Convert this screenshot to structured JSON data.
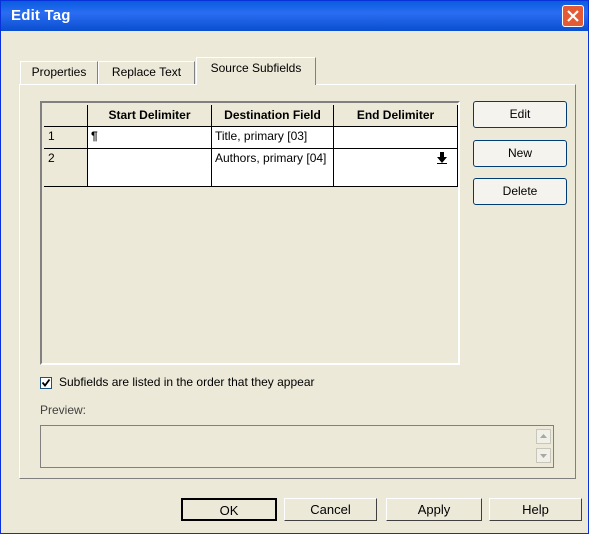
{
  "window": {
    "title": "Edit Tag",
    "title_bar_color": "#0a5cdf",
    "close_icon": "close-icon"
  },
  "tabs": [
    {
      "label": "Properties",
      "active": false
    },
    {
      "label": "Replace Text",
      "active": false
    },
    {
      "label": "Source Subfields",
      "active": true
    }
  ],
  "grid": {
    "columns": [
      "Start Delimiter",
      "Destination Field",
      "End Delimiter"
    ],
    "rows": [
      {
        "num": "1",
        "start": "¶",
        "dest": "Title, primary [03]",
        "end": ""
      },
      {
        "num": "2",
        "start": "",
        "dest": "Authors, primary [04]",
        "end": ""
      }
    ]
  },
  "side_buttons": {
    "edit": "Edit",
    "new": "New",
    "delete": "Delete"
  },
  "checkbox": {
    "label": "Subfields are listed in the order that they appear",
    "checked": true
  },
  "preview": {
    "label": "Preview:"
  },
  "footer": {
    "ok": "OK",
    "cancel": "Cancel",
    "apply": "Apply",
    "help": "Help"
  }
}
